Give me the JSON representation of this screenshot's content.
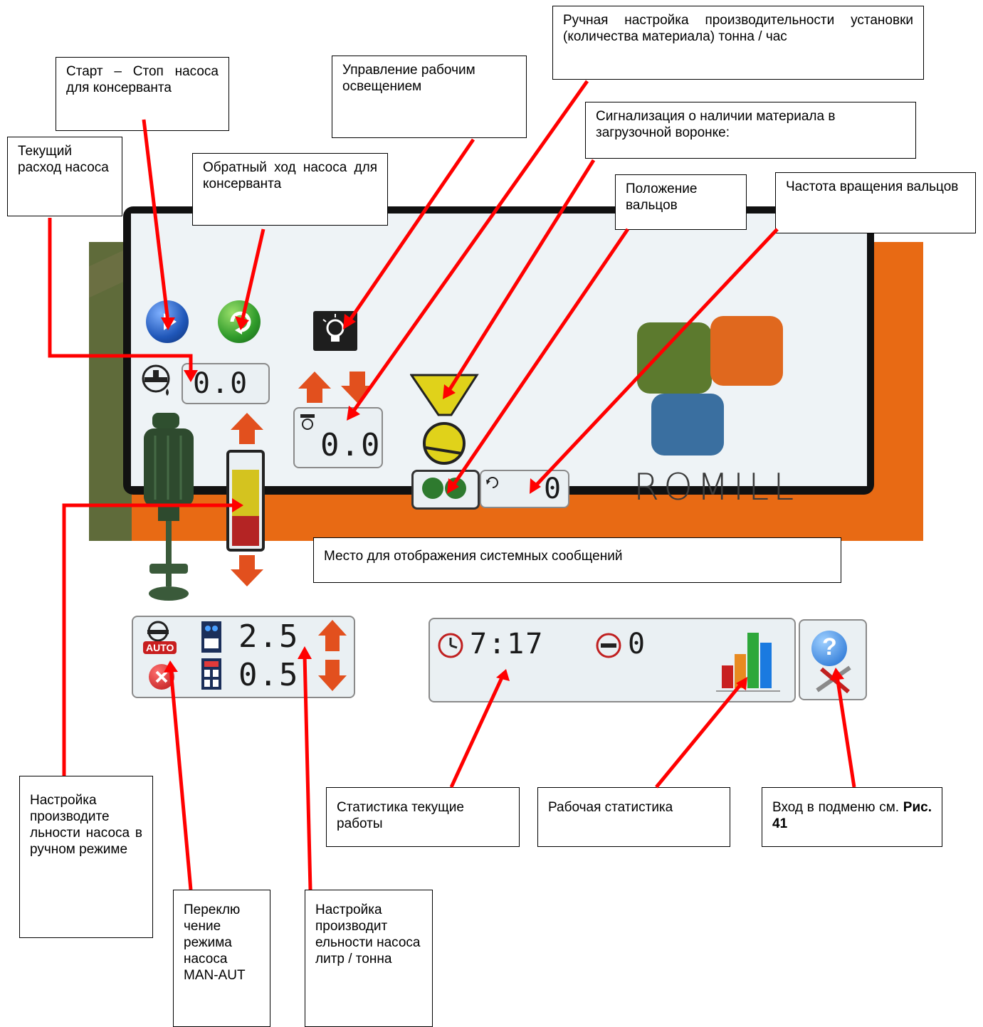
{
  "screen": {
    "pump_flow_value": "0.0",
    "capacity_value": "0.0",
    "roller_speed_value": "0",
    "pump_rate_1": "2.5",
    "pump_rate_2": "0.5",
    "auto_label": "AUTO",
    "work_time": "7:17",
    "counter_value": "0",
    "logo_text": "ROMILL",
    "level_fill_yellow": 0.55,
    "level_fill_red": 0.35
  },
  "callouts": {
    "start_stop": "Старт – Стоп насоса для консерванта",
    "reverse": "Обратный ход насоса для консерванта",
    "lighting": "Управление рабочим освещением",
    "capacity_manual": "Ручная настройка производительности установки (количества материала) тонна / час",
    "hopper_signal": "Сигнализация о наличии материала в загрузочной воронке:",
    "roller_position": "Положение вальцов",
    "roller_speed": "Частота вращения вальцов",
    "current_flow": "Текущий расход насоса",
    "system_messages": "Место для отображения системных сообщений",
    "pump_manual": "Настройка производите льности насоса в ручном режиме",
    "mode_switch": "Переклю чение режима насоса MAN-AUT",
    "pump_rate": "Настройка производит ельности насоса литр / тонна",
    "current_stats": "Статистика текущие работы",
    "work_stats": "Рабочая статистика",
    "submenu_prefix": "Вход в подменю см.",
    "submenu_ref": "Рис. 41"
  },
  "colors": {
    "arrow": "#ff0000",
    "orange": "#e86a14",
    "tile_green": "#5c7a2e",
    "tile_orange": "#e0681e",
    "tile_blue": "#3a6fa0"
  }
}
